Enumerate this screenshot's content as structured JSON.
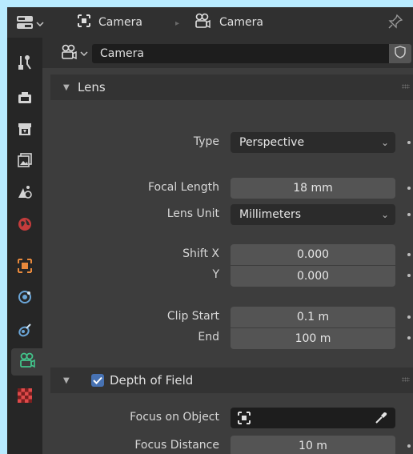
{
  "header": {
    "editor_type_icon": "properties-editor-icon",
    "breadcrumb_object": "Camera",
    "breadcrumb_data": "Camera",
    "pin_icon": "pin-icon"
  },
  "sidebar": {
    "tabs": [
      {
        "name": "tool",
        "icon": "tool-icon"
      },
      {
        "name": "render",
        "icon": "render-icon"
      },
      {
        "name": "output",
        "icon": "output-icon"
      },
      {
        "name": "view-layer",
        "icon": "view-layer-icon"
      },
      {
        "name": "scene",
        "icon": "scene-icon"
      },
      {
        "name": "world",
        "icon": "world-icon"
      },
      {
        "name": "object",
        "icon": "object-icon"
      },
      {
        "name": "physics",
        "icon": "physics-icon"
      },
      {
        "name": "constraints",
        "icon": "constraints-icon"
      },
      {
        "name": "camera-data",
        "icon": "camera-data-icon",
        "active": true
      },
      {
        "name": "texture",
        "icon": "texture-icon"
      }
    ]
  },
  "datablock": {
    "name": "Camera"
  },
  "lens_panel": {
    "title": "Lens",
    "type_label": "Type",
    "type_value": "Perspective",
    "focal_length_label": "Focal Length",
    "focal_length_value": "18 mm",
    "lens_unit_label": "Lens Unit",
    "lens_unit_value": "Millimeters",
    "shift_x_label": "Shift X",
    "shift_x_value": "0.000",
    "shift_y_label": "Y",
    "shift_y_value": "0.000",
    "clip_start_label": "Clip Start",
    "clip_start_value": "0.1 m",
    "clip_end_label": "End",
    "clip_end_value": "100 m"
  },
  "dof_panel": {
    "title": "Depth of Field",
    "enabled": true,
    "focus_object_label": "Focus on Object",
    "focus_object_value": "",
    "focus_distance_label": "Focus Distance",
    "focus_distance_value": "10 m"
  },
  "colors": {
    "accent": "#4772b3",
    "active_tab_icon": "#42c38a"
  }
}
